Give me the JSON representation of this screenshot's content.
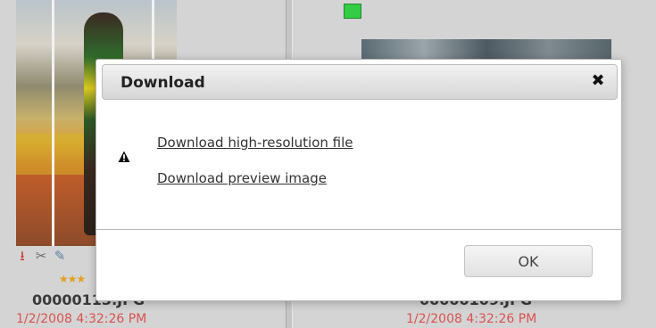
{
  "gallery": {
    "left_item": {
      "filename": "00000113.JPG",
      "date": "1/2/2008 4:32:26 PM",
      "rating_stars": "★★★"
    },
    "right_item": {
      "filename": "00000109.JPG",
      "date": "1/2/2008 4:32:26 PM"
    },
    "toolbar_icons": [
      "download-icon",
      "cut-icon",
      "edit-icon"
    ]
  },
  "modal": {
    "title": "Download",
    "close_glyph": "✖",
    "links": {
      "high_res": "Download high-resolution file",
      "preview": "Download preview image"
    },
    "ok_label": "OK"
  },
  "colors": {
    "date_text": "#d9534f",
    "status_green": "#33cc44"
  }
}
